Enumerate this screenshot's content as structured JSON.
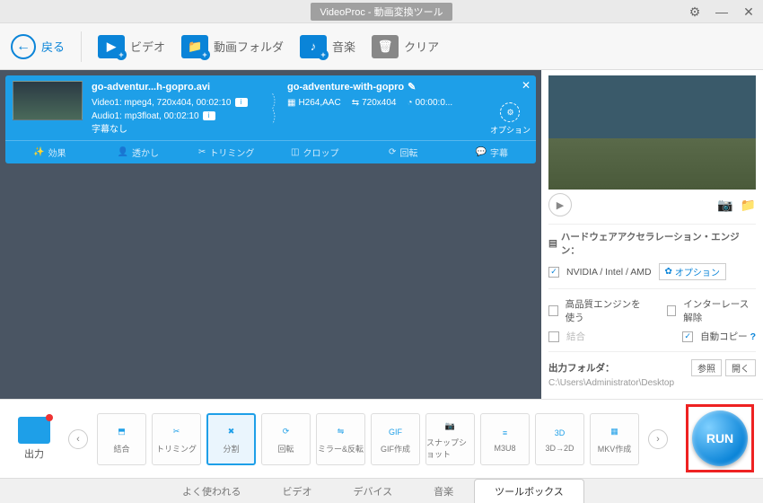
{
  "window": {
    "title": "VideoProc - 動画変換ツール"
  },
  "toolbar": {
    "back": "戻る",
    "video": "ビデオ",
    "folder": "動画フォルダ",
    "music": "音楽",
    "clear": "クリア"
  },
  "item": {
    "filename": "go-adventur...h-gopro.avi",
    "video_line": "Video1: mpeg4, 720x404, 00:02:10",
    "audio_line": "Audio1: mp3float, 00:02:10",
    "subtitle_line": "字幕なし",
    "out_name": "go-adventure-with-gopro",
    "out_codec": "H264,AAC",
    "out_res": "720x404",
    "out_dur": "00:00:0...",
    "option_label": "オプション",
    "tools": {
      "effect": "効果",
      "watermark": "透かし",
      "trim": "トリミング",
      "crop": "クロップ",
      "rotate": "回転",
      "subtitle": "字幕"
    }
  },
  "side": {
    "hw_label": "ハードウェアアクセラレーション・エンジン：",
    "hw_value": "NVIDIA / Intel / AMD",
    "hw_option": "オプション",
    "hq": "高品質エンジンを使う",
    "deint": "インターレース解除",
    "merge": "結合",
    "autocopy": "自動コピー",
    "outfolder_label": "出力フォルダ：",
    "browse": "参照",
    "open": "開く",
    "outpath": "C:\\Users\\Administrator\\Desktop"
  },
  "bottom": {
    "out": "出力",
    "presets": [
      "結合",
      "トリミング",
      "分割",
      "回転",
      "ミラー&反転",
      "GIF作成",
      "スナップショット",
      "M3U8",
      "3D→2D",
      "MKV作成"
    ],
    "active_index": 2,
    "run": "RUN"
  },
  "tabs": {
    "items": [
      "よく使われる",
      "ビデオ",
      "デバイス",
      "音楽",
      "ツールボックス"
    ],
    "active_index": 4
  }
}
